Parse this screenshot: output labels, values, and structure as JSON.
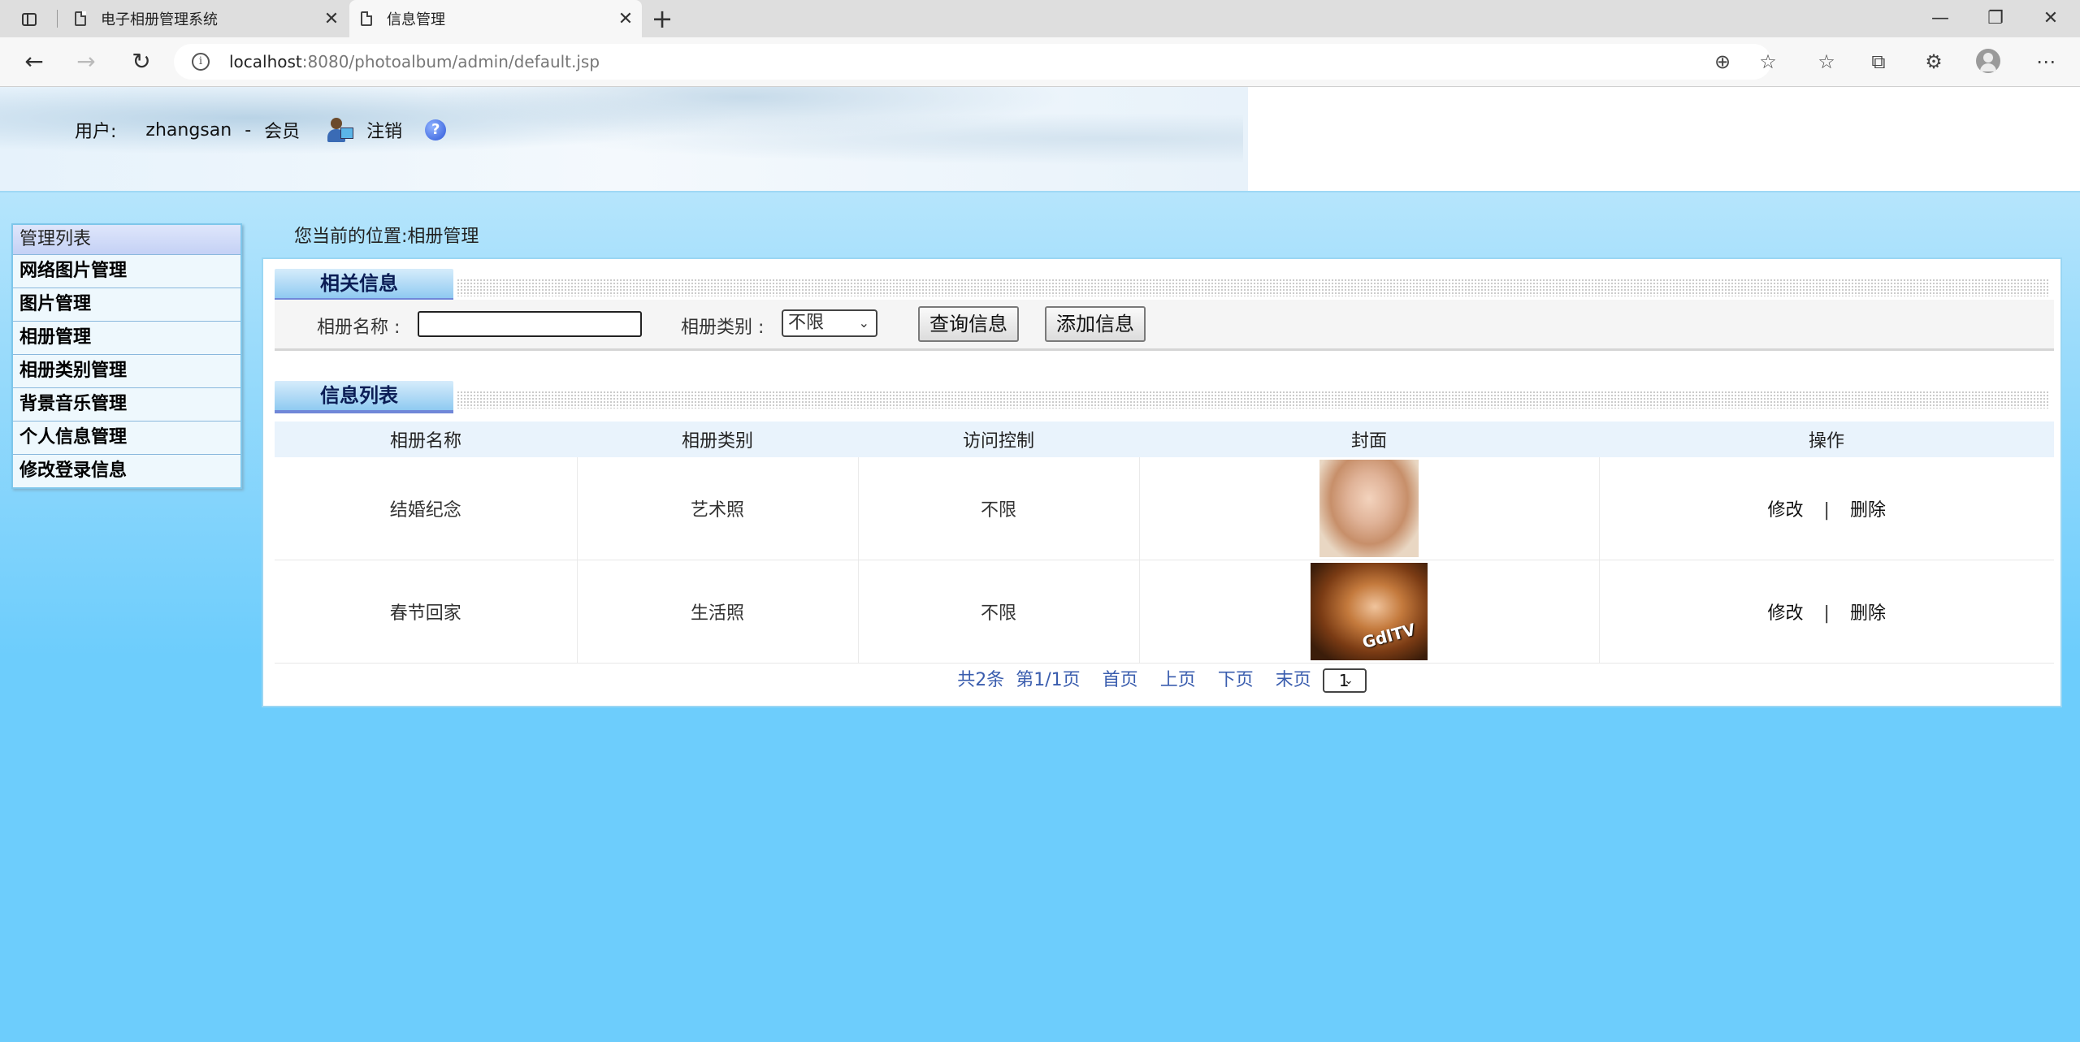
{
  "browser": {
    "tabs": [
      {
        "title": "电子相册管理系统"
      },
      {
        "title": "信息管理"
      }
    ],
    "url_host": "localhost",
    "url_rest": ":8080/photoalbum/admin/default.jsp"
  },
  "header": {
    "user_label": "用户:",
    "username": "zhangsan",
    "separator": "-",
    "role": "会员",
    "logout": "注销"
  },
  "sidebar": {
    "title": "管理列表",
    "items": [
      {
        "label": "网络图片管理"
      },
      {
        "label": "图片管理"
      },
      {
        "label": "相册管理"
      },
      {
        "label": "相册类别管理"
      },
      {
        "label": "背景音乐管理"
      },
      {
        "label": "个人信息管理"
      },
      {
        "label": "修改登录信息"
      }
    ]
  },
  "breadcrumb": "您当前的位置:相册管理",
  "search_section": {
    "title": "相关信息",
    "name_label": "相册名称 :",
    "name_value": "",
    "type_label": "相册类别 :",
    "type_selected": "不限",
    "query_button": "查询信息",
    "add_button": "添加信息"
  },
  "list_section": {
    "title": "信息列表",
    "columns": [
      "相册名称",
      "相册类别",
      "访问控制",
      "封面",
      "操作"
    ],
    "rows": [
      {
        "name": "结婚纪念",
        "type": "艺术照",
        "access": "不限",
        "edit": "修改",
        "sep": "|",
        "delete": "删除"
      },
      {
        "name": "春节回家",
        "type": "生活照",
        "access": "不限",
        "edit": "修改",
        "sep": "|",
        "delete": "删除",
        "cover_text": "GdlTV"
      }
    ]
  },
  "pager": {
    "total": "共2条",
    "page": "第1/1页",
    "first": "首页",
    "prev": "上页",
    "next": "下页",
    "last": "末页",
    "selected": "1"
  }
}
